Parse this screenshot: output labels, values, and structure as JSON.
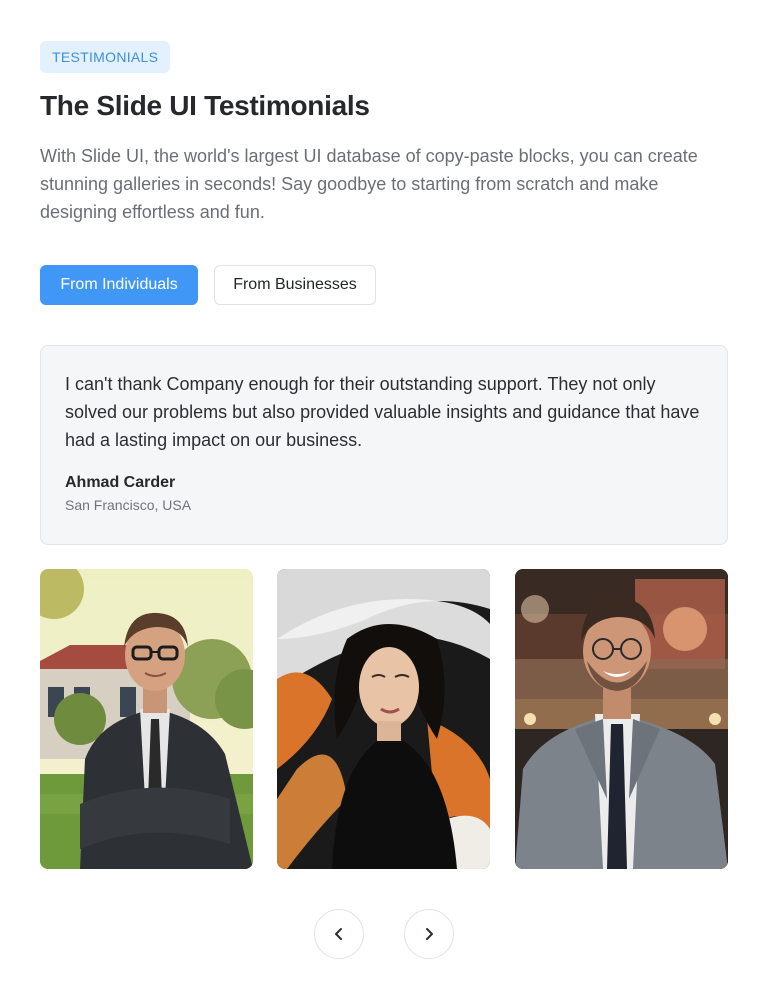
{
  "section": {
    "badge": "TESTIMONIALS",
    "title": "The Slide UI Testimonials",
    "intro": "With Slide UI, the world's largest UI database of copy-paste blocks, you can create stunning galleries in seconds! Say goodbye to starting from scratch and make designing effortless and fun."
  },
  "tabs": [
    {
      "label": "From Individuals",
      "active": true
    },
    {
      "label": "From Businesses",
      "active": false
    }
  ],
  "testimonial": {
    "quote": "I can't thank Company enough for their outstanding support. They not only solved our problems but also provided valuable insights and guidance that have had a lasting impact on our business.",
    "author": "Ahmad Carder",
    "location": "San Francisco, USA"
  },
  "gallery": [
    {
      "subject": "man in suit with glasses in front of house"
    },
    {
      "subject": "woman with flowing hair"
    },
    {
      "subject": "smiling man in grey suit with glasses"
    }
  ],
  "navigation": {
    "prev_icon": "chevron-left-icon",
    "next_icon": "chevron-right-icon"
  },
  "colors": {
    "accent": "#4197f5",
    "badge_bg": "#e3f0fd",
    "badge_text": "#3d8fe0",
    "card_bg": "#f5f6f8"
  }
}
